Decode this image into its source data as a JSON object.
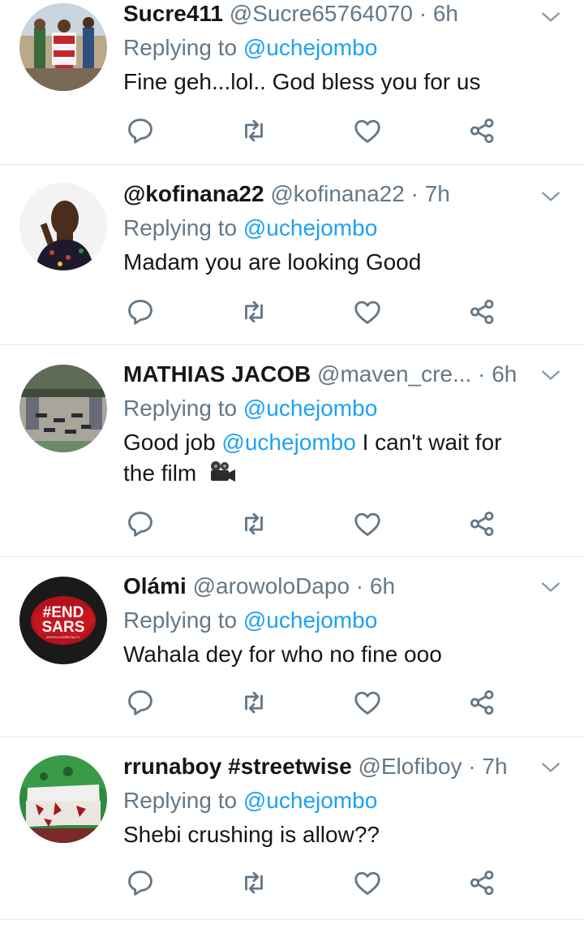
{
  "tweets": [
    {
      "name": "Sucre411",
      "handle": "@Sucre65764070",
      "dot": "·",
      "time": "6h",
      "replying_prefix": "Replying to",
      "replying_to": "@uchejombo",
      "text": "Fine geh...lol.. God bless you for us",
      "avatar": "protest-photo"
    },
    {
      "name": "@kofinana22",
      "handle": "@kofinana22",
      "dot": "·",
      "time": "7h",
      "replying_prefix": "Replying to",
      "replying_to": "@uchejombo",
      "text": "Madam you are looking Good",
      "avatar": "person-photo"
    },
    {
      "name": "MATHIAS JACOB",
      "handle": "@maven_cre...",
      "dot": "·",
      "time": "6h",
      "replying_prefix": "Replying to",
      "replying_to": "@uchejombo",
      "text_before": "Good job",
      "text_mention": "@uchejombo",
      "text_after": "I can't wait for the film",
      "emoji": "movie-camera-icon",
      "avatar": "crowd-photo"
    },
    {
      "name": "Olámi",
      "handle": "@arowoloDapo",
      "dot": "·",
      "time": "6h",
      "replying_prefix": "Replying to",
      "replying_to": "@uchejombo",
      "text": "Wahala dey for who no fine ooo",
      "avatar": "endsars-logo",
      "avatar_text_1": "#END",
      "avatar_text_2": "SARS",
      "avatar_text_3": "#ENDPOLICEBRUTALITY"
    },
    {
      "name": "rrunaboy #streetwise",
      "handle": "@Elofiboy",
      "dot": "·",
      "time": "7h",
      "replying_prefix": "Replying to",
      "replying_to": "@uchejombo",
      "text": "Shebi crushing is allow??",
      "avatar": "flag-photo"
    }
  ],
  "icons": [
    "reply-icon",
    "retweet-icon",
    "like-icon",
    "share-icon",
    "chevron-down-icon"
  ],
  "colors": {
    "accent": "#1da1f2",
    "muted": "#657786",
    "text": "#14171a",
    "divider": "#e1e8ed"
  }
}
